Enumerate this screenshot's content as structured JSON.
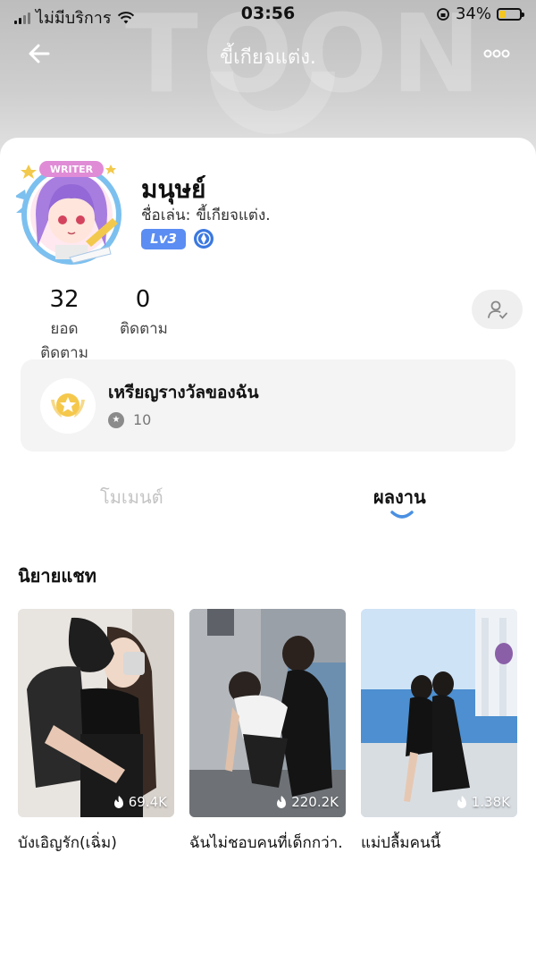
{
  "status_bar": {
    "carrier": "ไม่มีบริการ",
    "time": "03:56",
    "battery": "34%",
    "battery_level": 0.34
  },
  "header": {
    "title": "ขี้เกียจแต่ง.",
    "watermark": "TOON"
  },
  "profile": {
    "name": "มนุษย์",
    "nickname_label": "ชื่อเล่น:",
    "nickname": "ขี้เกียจแต่ง.",
    "level": "Lv3",
    "avatar_badge": "WRITER"
  },
  "stats": [
    {
      "value": "32",
      "label": "ยอดติดตาม"
    },
    {
      "value": "0",
      "label": "ติดตาม"
    }
  ],
  "awards": {
    "title": "เหรียญรางวัลของฉัน",
    "count": "10"
  },
  "tabs": [
    {
      "label": "โมเมนต์"
    },
    {
      "label": "ผลงาน"
    }
  ],
  "section": {
    "title": "นิยายแชท"
  },
  "works": [
    {
      "title": "บังเอิญรัก(เฉิ่ม)",
      "views": "69.4K"
    },
    {
      "title": "ฉันไม่ชอบคนที่เด็กกว่า.",
      "views": "220.2K"
    },
    {
      "title": "แม่ปลื้มคนนี้",
      "views": "1.38K"
    }
  ],
  "colors": {
    "accent": "#5b8df2",
    "tab_indicator": "#4a90e2",
    "battery": "#f3c623"
  },
  "icons": [
    "back-arrow-icon",
    "more-icon",
    "wifi-icon",
    "follow-user-icon",
    "medal-icon",
    "star-icon",
    "flame-icon",
    "verified-icon"
  ]
}
